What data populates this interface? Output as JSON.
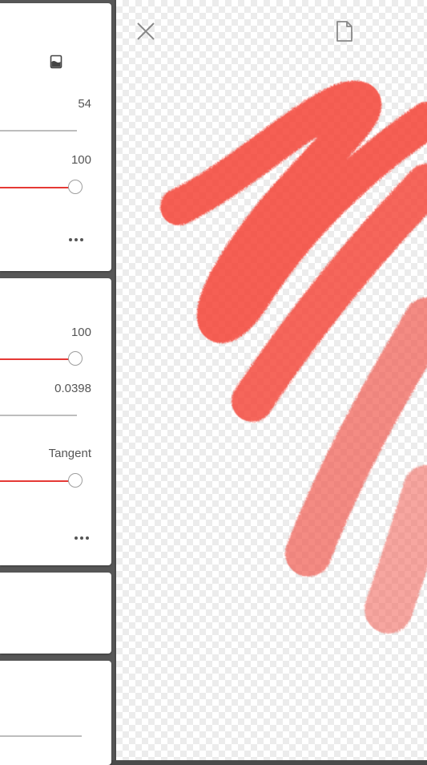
{
  "panel": {
    "card1": {
      "icon": "ink-well-icon",
      "value_a": "54",
      "value_b": "100",
      "more_icon": "more-horizontal-icon"
    },
    "card2": {
      "value_a": "100",
      "value_b": "0.0398",
      "value_c": "Tangent",
      "more_icon": "more-horizontal-icon"
    }
  },
  "canvas": {
    "close_icon": "close-icon",
    "document_icon": "document-icon",
    "stroke_color": "#f44336"
  }
}
